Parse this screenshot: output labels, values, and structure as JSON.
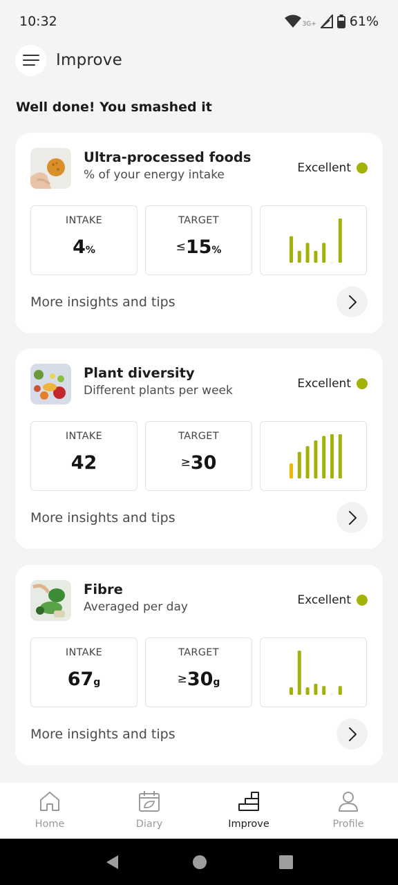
{
  "status_bar": {
    "time": "10:32",
    "network": "3G+",
    "battery": "61%",
    "icons": [
      "wifi-icon",
      "signal-icon",
      "battery-icon"
    ]
  },
  "header": {
    "title": "Improve",
    "menu_icon": "hamburger-menu-icon"
  },
  "heading": "Well done! You smashed it",
  "cards": [
    {
      "title": "Ultra-processed foods",
      "subtitle": "% of your energy intake",
      "status": "Excellent",
      "status_color": "#a3b10b",
      "intake_label": "INTAKE",
      "intake_value": "4",
      "intake_unit": "%",
      "target_label": "TARGET",
      "target_qualifier": "≤",
      "target_value": "15",
      "target_unit": "%",
      "link": "More insights and tips",
      "trend_bars": [
        0.6,
        0.27,
        0.45,
        0.27,
        0.45,
        0.0,
        1.0
      ]
    },
    {
      "title": "Plant diversity",
      "subtitle": "Different plants per week",
      "status": "Excellent",
      "status_color": "#a3b10b",
      "intake_label": "INTAKE",
      "intake_value": "42",
      "intake_unit": "",
      "target_label": "TARGET",
      "target_qualifier": "≥",
      "target_value": "30",
      "target_unit": "",
      "link": "More insights and tips",
      "trend_bars": [
        0.34,
        0.6,
        0.73,
        0.86,
        0.96,
        1.0,
        1.0
      ]
    },
    {
      "title": "Fibre",
      "subtitle": "Averaged per day",
      "status": "Excellent",
      "status_color": "#a3b10b",
      "intake_label": "INTAKE",
      "intake_value": "67",
      "intake_unit": "g",
      "target_label": "TARGET",
      "target_qualifier": "≥",
      "target_value": "30",
      "target_unit": "g",
      "link": "More insights and tips",
      "trend_bars": [
        0.17,
        1.0,
        0.17,
        0.25,
        0.2,
        0.0,
        0.2
      ]
    }
  ],
  "bottom_nav": [
    {
      "label": "Home",
      "icon": "home-icon",
      "active": false
    },
    {
      "label": "Diary",
      "icon": "diary-icon",
      "active": false
    },
    {
      "label": "Improve",
      "icon": "improve-icon",
      "active": true
    },
    {
      "label": "Profile",
      "icon": "profile-icon",
      "active": false
    }
  ],
  "colors": {
    "accent_green": "#a3b10b",
    "warm_yellow": "#f2b705",
    "background": "#f4f4f4"
  }
}
